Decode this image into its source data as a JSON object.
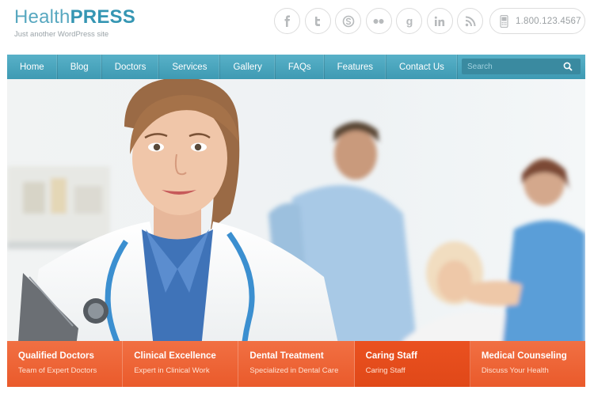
{
  "brand": {
    "name_light": "Health",
    "name_bold": "PRESS",
    "tagline": "Just another WordPress site"
  },
  "social": [
    {
      "icon": "facebook-icon"
    },
    {
      "icon": "twitter-icon"
    },
    {
      "icon": "skype-icon"
    },
    {
      "icon": "flickr-icon"
    },
    {
      "icon": "google-icon"
    },
    {
      "icon": "linkedin-icon"
    },
    {
      "icon": "rss-icon"
    }
  ],
  "phone": "1.800.123.4567",
  "nav": {
    "items": [
      "Home",
      "Blog",
      "Doctors",
      "Services",
      "Gallery",
      "FAQs",
      "Features",
      "Contact Us"
    ],
    "search_placeholder": "Search"
  },
  "features": [
    {
      "title": "Qualified Doctors",
      "subtitle": "Team of Expert Doctors"
    },
    {
      "title": "Clinical Excellence",
      "subtitle": "Expert in Clinical Work"
    },
    {
      "title": "Dental Treatment",
      "subtitle": "Specialized in Dental Care"
    },
    {
      "title": "Caring Staff",
      "subtitle": "Caring Staff"
    },
    {
      "title": "Medical Counseling",
      "subtitle": "Discuss Your Health"
    }
  ],
  "colors": {
    "accent": "#3e9ab3",
    "orange": "#ea5a2b",
    "orange_active": "#e04818"
  }
}
